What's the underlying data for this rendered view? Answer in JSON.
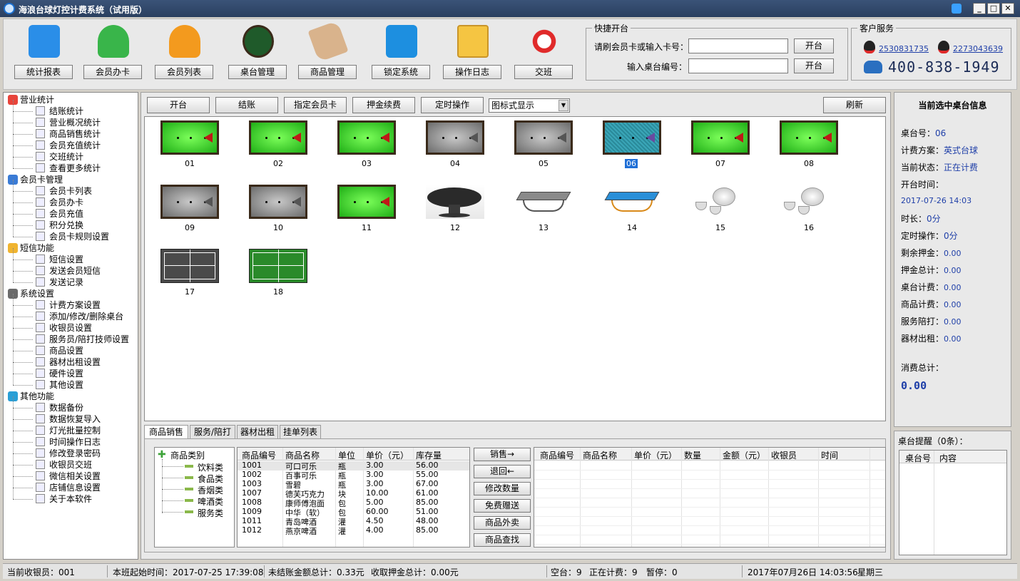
{
  "window": {
    "title": "海浪台球灯控计费系统（试用版）"
  },
  "toolbar": [
    {
      "label": "统计报表",
      "icon": "bar-chart-icon",
      "color": "#2a8ee8"
    },
    {
      "label": "会员办卡",
      "icon": "add-member-icon",
      "color": "#39b54a"
    },
    {
      "label": "会员列表",
      "icon": "members-list-icon",
      "color": "#f39a1e"
    },
    {
      "label": "桌台管理",
      "icon": "billiard-rack-icon",
      "color": "#1f5a2a"
    },
    {
      "label": "商品管理",
      "icon": "price-tag-gear-icon",
      "color": "#d9b38c"
    },
    {
      "label": "锁定系统",
      "icon": "lock-icon",
      "color": "#1d8fe0"
    },
    {
      "label": "操作日志",
      "icon": "checklist-icon",
      "color": "#f5c542"
    },
    {
      "label": "交班",
      "icon": "spinner-icon",
      "color": "#e02a2a"
    }
  ],
  "quick_open": {
    "legend": "快捷开台",
    "card_label": "请刷会员卡或输入卡号：",
    "table_label": "输入桌台编号：",
    "open_btn": "开台",
    "open_btn2": "开台"
  },
  "customer_service": {
    "legend": "客户服务",
    "qq1": "2530831735",
    "qq2": "2273043639",
    "phone": "400-838-1949"
  },
  "nav": [
    {
      "type": "cat",
      "label": "营业统计",
      "icon": "pie-chart-icon",
      "color": "#e8443a"
    },
    {
      "type": "item",
      "label": "结账统计",
      "icon": "document-icon"
    },
    {
      "type": "item",
      "label": "营业概况统计",
      "icon": "document-icon"
    },
    {
      "type": "item",
      "label": "商品销售统计",
      "icon": "document-icon"
    },
    {
      "type": "item",
      "label": "会员充值统计",
      "icon": "document-icon"
    },
    {
      "type": "item",
      "label": "交班统计",
      "icon": "document-icon"
    },
    {
      "type": "item",
      "label": "查看更多统计",
      "icon": "ellipsis-icon"
    },
    {
      "type": "cat",
      "label": "会员卡管理",
      "icon": "user-icon",
      "color": "#3a7bd5"
    },
    {
      "type": "item",
      "label": "会员卡列表",
      "icon": "users-icon"
    },
    {
      "type": "item",
      "label": "会员办卡",
      "icon": "add-user-icon"
    },
    {
      "type": "item",
      "label": "会员充值",
      "icon": "recharge-icon"
    },
    {
      "type": "item",
      "label": "积分兑换",
      "icon": "gift-icon"
    },
    {
      "type": "item",
      "label": "会员卡规则设置",
      "icon": "settings-icon"
    },
    {
      "type": "cat",
      "label": "短信功能",
      "icon": "envelope-icon",
      "color": "#f0b430"
    },
    {
      "type": "item",
      "label": "短信设置",
      "icon": "sms-settings-icon"
    },
    {
      "type": "item",
      "label": "发送会员短信",
      "icon": "send-sms-icon"
    },
    {
      "type": "item",
      "label": "发送记录",
      "icon": "list-icon"
    },
    {
      "type": "cat",
      "label": "系统设置",
      "icon": "gear-icon",
      "color": "#6b6b6b"
    },
    {
      "type": "item",
      "label": "计费方案设置",
      "icon": "tag-icon"
    },
    {
      "type": "item",
      "label": "添加/修改/删除桌台",
      "icon": "billiard-icon"
    },
    {
      "type": "item",
      "label": "收银员设置",
      "icon": "cashier-icon"
    },
    {
      "type": "item",
      "label": "服务员/陪打技师设置",
      "icon": "waiter-icon"
    },
    {
      "type": "item",
      "label": "商品设置",
      "icon": "goods-icon"
    },
    {
      "type": "item",
      "label": "器材出租设置",
      "icon": "rent-icon"
    },
    {
      "type": "item",
      "label": "硬件设置",
      "icon": "hardware-icon"
    },
    {
      "type": "item",
      "label": "其他设置",
      "icon": "tools-icon"
    },
    {
      "type": "cat",
      "label": "其他功能",
      "icon": "cube-icon",
      "color": "#2a9fd6"
    },
    {
      "type": "item",
      "label": "数据备份",
      "icon": "backup-icon"
    },
    {
      "type": "item",
      "label": "数据恢复导入",
      "icon": "restore-icon"
    },
    {
      "type": "item",
      "label": "灯光批量控制",
      "icon": "bulb-icon"
    },
    {
      "type": "item",
      "label": "时间操作日志",
      "icon": "clock-icon"
    },
    {
      "type": "item",
      "label": "修改登录密码",
      "icon": "key-icon"
    },
    {
      "type": "item",
      "label": "收银员交班",
      "icon": "shift-icon"
    },
    {
      "type": "item",
      "label": "微信相关设置",
      "icon": "wechat-icon"
    },
    {
      "type": "item",
      "label": "店铺信息设置",
      "icon": "shop-icon"
    },
    {
      "type": "item",
      "label": "关于本软件",
      "icon": "info-icon"
    }
  ],
  "action_bar": {
    "open": "开台",
    "checkout": "结账",
    "assign_card": "指定会员卡",
    "deposit": "押金续费",
    "timer": "定时操作",
    "view_mode": "图标式显示",
    "refresh": "刷新"
  },
  "tables": [
    {
      "no": "01",
      "kind": "snooker-green"
    },
    {
      "no": "02",
      "kind": "snooker-green"
    },
    {
      "no": "03",
      "kind": "snooker-green"
    },
    {
      "no": "04",
      "kind": "snooker-gray"
    },
    {
      "no": "05",
      "kind": "snooker-gray"
    },
    {
      "no": "06",
      "kind": "snooker-selected"
    },
    {
      "no": "07",
      "kind": "snooker-green"
    },
    {
      "no": "08",
      "kind": "snooker-green"
    },
    {
      "no": "09",
      "kind": "snooker-gray"
    },
    {
      "no": "10",
      "kind": "snooker-gray"
    },
    {
      "no": "11",
      "kind": "snooker-green"
    },
    {
      "no": "12",
      "kind": "round-table"
    },
    {
      "no": "13",
      "kind": "pingpong-gray"
    },
    {
      "no": "14",
      "kind": "pingpong-blue"
    },
    {
      "no": "15",
      "kind": "tea-set"
    },
    {
      "no": "16",
      "kind": "tea-set"
    },
    {
      "no": "17",
      "kind": "badminton-gray"
    },
    {
      "no": "18",
      "kind": "badminton-green"
    }
  ],
  "bottom_tabs": [
    "商品销售",
    "服务/陪打",
    "器材出租",
    "挂单列表"
  ],
  "goods_tree": {
    "root": "商品类别",
    "children": [
      "饮料类",
      "食品类",
      "香烟类",
      "啤酒类",
      "服务类"
    ]
  },
  "goods_table": {
    "headers": [
      "商品编号",
      "商品名称",
      "单位",
      "单价（元）",
      "库存量"
    ],
    "rows": [
      [
        "1001",
        "可口可乐",
        "瓶",
        "3.00",
        "56.00"
      ],
      [
        "1002",
        "百事可乐",
        "瓶",
        "3.00",
        "55.00"
      ],
      [
        "1003",
        "雪碧",
        "瓶",
        "3.00",
        "67.00"
      ],
      [
        "1007",
        "德芙巧克力",
        "块",
        "10.00",
        "61.00"
      ],
      [
        "1008",
        "康师傅泡面",
        "包",
        "5.00",
        "85.00"
      ],
      [
        "1009",
        "中华（软）",
        "包",
        "60.00",
        "51.00"
      ],
      [
        "1011",
        "青岛啤酒",
        "灌",
        "4.50",
        "48.00"
      ],
      [
        "1012",
        "燕京啤酒",
        "灌",
        "4.00",
        "85.00"
      ]
    ]
  },
  "sale_buttons": [
    "销售→",
    "退回←",
    "修改数量",
    "免费赠送",
    "商品外卖",
    "商品查找"
  ],
  "sold_table": {
    "headers": [
      "商品编号",
      "商品名称",
      "单价（元）",
      "数量",
      "金额（元）",
      "收银员",
      "时间"
    ]
  },
  "selected_info": {
    "title": "当前选中桌台信息",
    "rows": [
      {
        "k": "桌台号：",
        "v": "06"
      },
      {
        "k": "计费方案：",
        "v": "英式台球"
      },
      {
        "k": "当前状态：",
        "v": "正在计费"
      },
      {
        "k": "开台时间：",
        "v": ""
      },
      {
        "k": "",
        "v": "2017-07-26 14:03"
      },
      {
        "k": "时长：",
        "v": "0分"
      },
      {
        "k": "定时操作：",
        "v": "0分"
      },
      {
        "k": "剩余押金：",
        "v": "0.00"
      },
      {
        "k": "押金总计：",
        "v": "0.00"
      },
      {
        "k": "桌台计费：",
        "v": "0.00"
      },
      {
        "k": "商品计费：",
        "v": "0.00"
      },
      {
        "k": "服务陪打：",
        "v": "0.00"
      },
      {
        "k": "器材出租：",
        "v": "0.00"
      }
    ],
    "total_label": "消费总计：",
    "total_value": "0.00"
  },
  "reminder": {
    "title": "桌台提醒（0条）：",
    "headers": [
      "桌台号",
      "内容"
    ]
  },
  "status": {
    "cashier": "当前收银员：001",
    "shift_start": "本班起始时间：2017-07-25 17:39:08",
    "unsettled": "未结账金额总计：0.33元",
    "deposit": "收取押金总计：0.00元",
    "idle": "空台：9",
    "billing": "正在计费：9",
    "paused": "暂停：0",
    "datetime": "2017年07月26日 14:03:56",
    "weekday": "星期三"
  }
}
